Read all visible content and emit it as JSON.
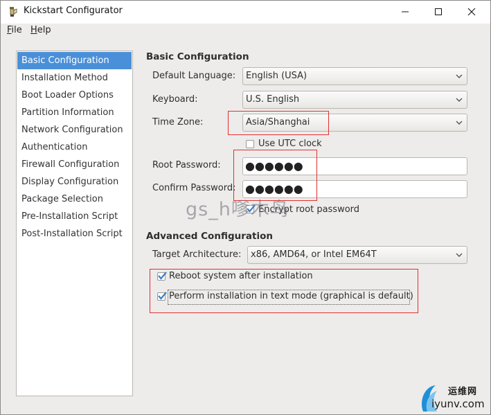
{
  "window": {
    "title": "Kickstart Configurator"
  },
  "menubar": {
    "file": {
      "mnemonic": "F",
      "rest": "ile"
    },
    "help": {
      "mnemonic": "H",
      "rest": "elp"
    }
  },
  "sidebar": {
    "items": [
      {
        "label": "Basic Configuration",
        "selected": true
      },
      {
        "label": "Installation Method"
      },
      {
        "label": "Boot Loader Options"
      },
      {
        "label": "Partition Information"
      },
      {
        "label": "Network Configuration"
      },
      {
        "label": "Authentication"
      },
      {
        "label": "Firewall Configuration"
      },
      {
        "label": "Display Configuration"
      },
      {
        "label": "Package Selection"
      },
      {
        "label": "Pre-Installation Script"
      },
      {
        "label": "Post-Installation Script"
      }
    ]
  },
  "basic": {
    "title": "Basic Configuration",
    "language_label": "Default Language:",
    "language_value": "English (USA)",
    "keyboard_label": "Keyboard:",
    "keyboard_value": "U.S. English",
    "timezone_label": "Time Zone:",
    "timezone_value": "Asia/Shanghai",
    "utc_label": "Use UTC clock",
    "utc_checked": false,
    "root_pw_label": "Root Password:",
    "root_pw_value": "●●●●●●",
    "confirm_pw_label": "Confirm Password:",
    "confirm_pw_value": "●●●●●●",
    "encrypt_label": "Encrypt root password",
    "encrypt_checked": true
  },
  "advanced": {
    "title": "Advanced Configuration",
    "arch_label": "Target Architecture:",
    "arch_value": "x86, AMD64, or Intel EM64T",
    "reboot_label": "Reboot system after installation",
    "reboot_checked": true,
    "textmode_label": "Perform installation in text mode (graphical is default)",
    "textmode_checked": true
  },
  "watermark": "gs_h嗲木鸟",
  "brand": {
    "top": "运维网",
    "bottom": "iyunv.com"
  },
  "colors": {
    "selection": "#4a90d9",
    "annotation": "#e03030",
    "check": "#3d7fc7"
  }
}
